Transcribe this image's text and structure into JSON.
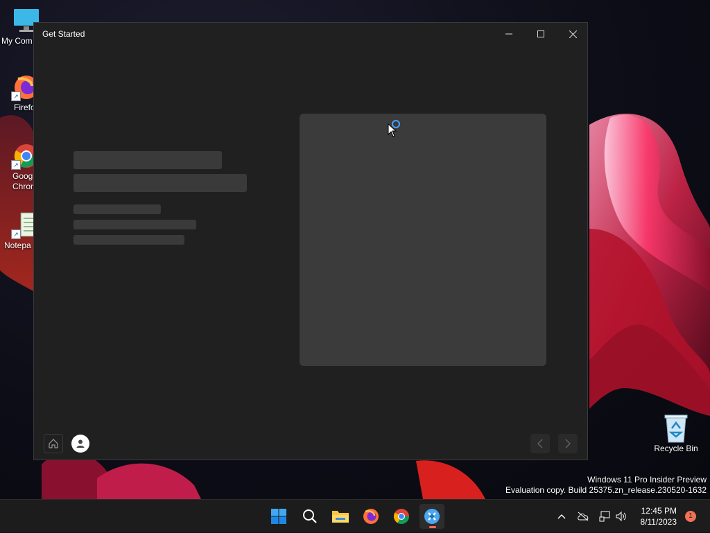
{
  "desktop": {
    "icons": [
      {
        "label": "My Com",
        "icon": "monitor-icon"
      },
      {
        "label": "Firefo",
        "icon": "firefox-icon"
      },
      {
        "label": "Goog Chron",
        "icon": "chrome-icon"
      },
      {
        "label": "Notepa",
        "icon": "notepad-icon"
      }
    ],
    "recycle_bin": {
      "label": "Recycle Bin",
      "icon": "recycle-bin-icon"
    },
    "watermark": {
      "line1": "Windows 11 Pro Insider Preview",
      "line2": "Evaluation copy. Build 25375.zn_release.230520-1632"
    }
  },
  "window": {
    "title": "Get Started",
    "controls": {
      "minimize": "minimize-icon",
      "maximize": "maximize-icon",
      "close": "close-icon"
    },
    "footer": {
      "home": "home-icon",
      "account": "person-icon",
      "back": "chevron-left-icon",
      "next": "chevron-right-icon"
    }
  },
  "taskbar": {
    "apps": [
      "windows-start-icon",
      "search-icon",
      "file-explorer-icon",
      "firefox-icon",
      "chrome-icon",
      "get-started-icon"
    ],
    "tray": [
      "chevron-up-icon",
      "onedrive-icon",
      "network-icon",
      "volume-icon"
    ],
    "time": "12:45 PM",
    "date": "8/11/2023",
    "notification_count": "1"
  },
  "colors": {
    "accent": "#4aa3ff",
    "window_bg": "#202020",
    "taskbar_bg": "#1c1c1c",
    "badge": "#f07256"
  }
}
